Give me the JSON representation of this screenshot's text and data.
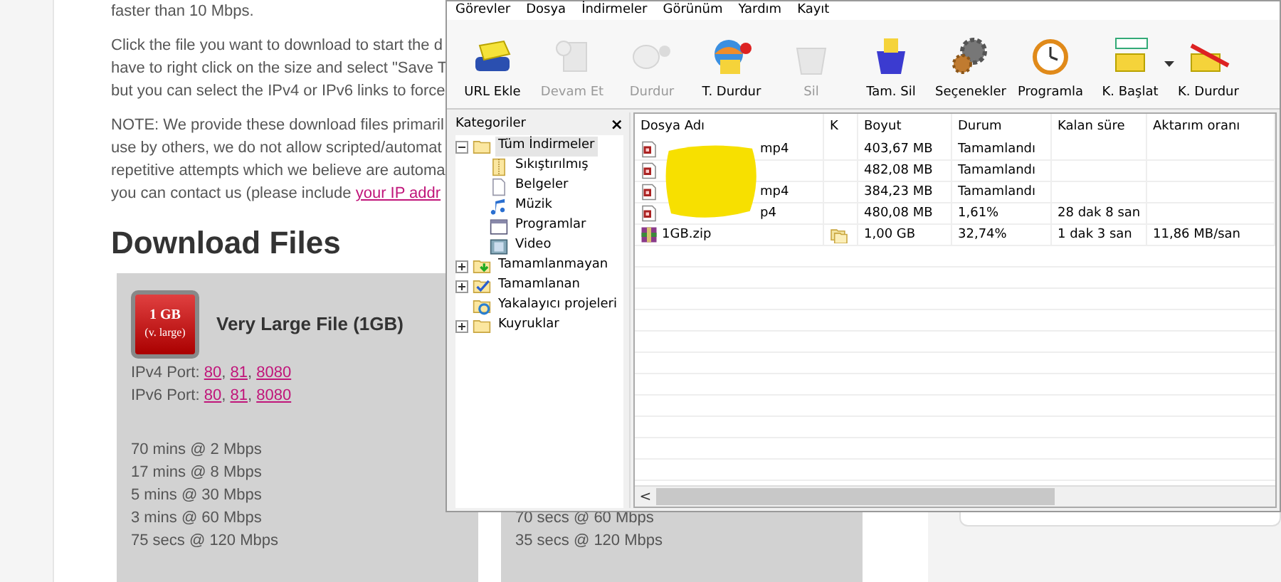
{
  "webpage": {
    "intro_line": "faster than 10 Mbps.",
    "paragraph_1": [
      "Click the file you want to download to start the d",
      "have to right click on the size and select \"Save T",
      "but you can select the IPv4 or IPv6 links to force"
    ],
    "paragraph_2": [
      "NOTE: We provide these download files primaril",
      "use by others, we do not allow scripted/automat",
      "repetitive attempts which we believe are automa"
    ],
    "paragraph_2_last": {
      "text": "you can contact us (please include ",
      "link": "your IP addr"
    },
    "heading": "Download Files",
    "cards": [
      {
        "badge_size": "1 GB",
        "badge_label": "(v. large)",
        "title": "Very Large File (1GB)",
        "ports": [
          {
            "label": "IPv4 Port:",
            "links": [
              "80",
              "81",
              "8080"
            ],
            "separator": ","
          },
          {
            "label": "IPv6 Port:",
            "links": [
              "80",
              "81",
              "8080"
            ],
            "separator": ","
          }
        ],
        "times": [
          "70 mins @ 2 Mbps",
          "17 mins @ 8 Mbps",
          "5 mins @ 30 Mbps",
          "3 mins @ 60 Mbps",
          "75 secs @ 120 Mbps"
        ]
      },
      {
        "times": [
          "70 secs @ 60 Mbps",
          "35 secs @ 120 Mbps"
        ]
      }
    ]
  },
  "app": {
    "menu": [
      "Görevler",
      "Dosya",
      "İndirmeler",
      "Görünüm",
      "Yardım",
      "Kayıt"
    ],
    "toolbar": [
      {
        "kind": "add",
        "label": "URL Ekle",
        "disabled": false
      },
      {
        "kind": "resume",
        "label": "Devam Et",
        "disabled": true
      },
      {
        "kind": "stop",
        "label": "Durdur",
        "disabled": true
      },
      {
        "kind": "stopall",
        "label": "T. Durdur",
        "disabled": false
      },
      {
        "kind": "delete",
        "label": "Sil",
        "disabled": true
      },
      {
        "kind": "deleteall",
        "label": "Tam. Sil",
        "disabled": false
      },
      {
        "kind": "options",
        "label": "Seçenekler",
        "disabled": false
      },
      {
        "kind": "schedule",
        "label": "Programla",
        "disabled": false
      },
      {
        "kind": "start",
        "label": "K. Başlat",
        "disabled": false,
        "dropdown": true
      },
      {
        "kind": "queuestop",
        "label": "K. Durdur",
        "disabled": false
      }
    ],
    "categories": {
      "title": "Kategoriler",
      "close": "×",
      "tree": [
        {
          "kind": "folder",
          "label": "Tüm İndirmeler",
          "selected": true,
          "expanded": true,
          "children": [
            {
              "kind": "archive",
              "label": "Sıkıştırılmış",
              "selected": false
            },
            {
              "kind": "document",
              "label": "Belgeler",
              "selected": false
            },
            {
              "kind": "music",
              "label": "Müzik",
              "selected": false
            },
            {
              "kind": "program",
              "label": "Programlar",
              "selected": false
            },
            {
              "kind": "video",
              "label": "Video",
              "selected": false
            }
          ]
        },
        {
          "kind": "incomplete",
          "label": "Tamamlanmayan",
          "selected": false,
          "expanded": false
        },
        {
          "kind": "complete",
          "label": "Tamamlanan",
          "selected": false,
          "expanded": false
        },
        {
          "kind": "grabber",
          "label": "Yakalayıcı projeleri",
          "selected": false
        },
        {
          "kind": "queue",
          "label": "Kuyruklar",
          "selected": false,
          "expanded": false
        }
      ]
    },
    "table": {
      "columns": [
        "Dosya Adı",
        "K",
        "Boyut",
        "Durum",
        "Kalan süre",
        "Aktarım oranı"
      ],
      "rows": [
        {
          "kind": "video",
          "name": "mp4",
          "queued": false,
          "size": "403,67 MB",
          "status": "Tamamlandı"
        },
        {
          "kind": "video",
          "queued": false,
          "size": "482,08 MB",
          "status": "Tamamlandı"
        },
        {
          "kind": "video",
          "name": "mp4",
          "queued": false,
          "size": "384,23 MB",
          "status": "Tamamlandı"
        },
        {
          "kind": "video",
          "name": "p4",
          "queued": false,
          "size": "480,08 MB",
          "status": "1,61%",
          "remaining": "28 dak 8 san"
        },
        {
          "kind": "archive",
          "name": "1GB.zip",
          "queued": true,
          "size": "1,00 GB",
          "status": "32,74%",
          "remaining": "1 dak 3 san",
          "rate": "11,86 MB/san"
        }
      ],
      "scroll_left": "<"
    }
  }
}
